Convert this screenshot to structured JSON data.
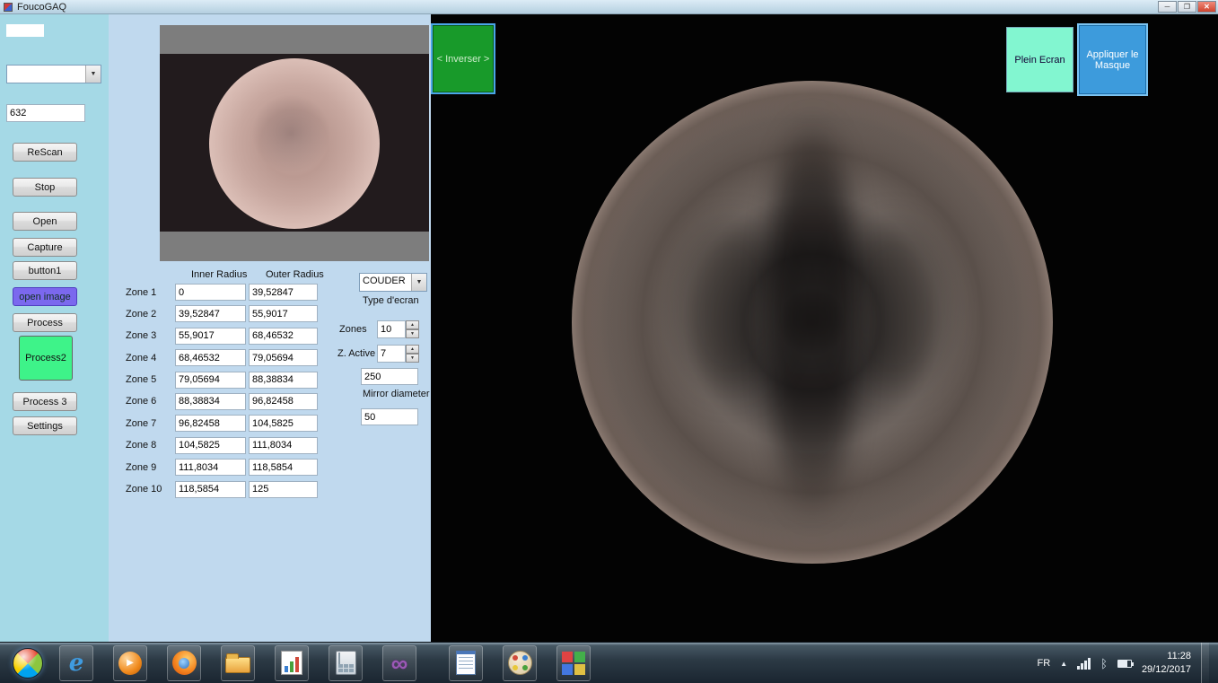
{
  "window": {
    "title": "FoucoGAQ"
  },
  "sidebar": {
    "combo_value": "",
    "wavelength": "632",
    "buttons": {
      "rescan": "ReScan",
      "stop": "Stop",
      "open": "Open",
      "capture": "Capture",
      "button1": "button1",
      "open_image": "open image",
      "process": "Process",
      "process2": "Process2",
      "process3": "Process 3",
      "settings": "Settings"
    }
  },
  "zones": {
    "inner_header": "Inner Radius",
    "outer_header": "Outer Radius",
    "rows": [
      {
        "label": "Zone 1",
        "inner": "0",
        "outer": "39,52847"
      },
      {
        "label": "Zone 2",
        "inner": "39,52847",
        "outer": "55,9017"
      },
      {
        "label": "Zone 3",
        "inner": "55,9017",
        "outer": "68,46532"
      },
      {
        "label": "Zone 4",
        "inner": "68,46532",
        "outer": "79,05694"
      },
      {
        "label": "Zone 5",
        "inner": "79,05694",
        "outer": "88,38834"
      },
      {
        "label": "Zone 6",
        "inner": "88,38834",
        "outer": "96,82458"
      },
      {
        "label": "Zone 7",
        "inner": "96,82458",
        "outer": "104,5825"
      },
      {
        "label": "Zone 8",
        "inner": "104,5825",
        "outer": "111,8034"
      },
      {
        "label": "Zone 9",
        "inner": "111,8034",
        "outer": "118,5854"
      },
      {
        "label": "Zone 10",
        "inner": "118,5854",
        "outer": "125"
      }
    ]
  },
  "controls": {
    "screen_type": "COUDER",
    "screen_type_label": "Type d'ecran",
    "zones_label": "Zones",
    "zones_count": "10",
    "active_label": "Z. Active",
    "active_count": "7",
    "radius_value": "250",
    "mirror_label": "Mirror diameter",
    "diameter_value": "50"
  },
  "viewer": {
    "inverser_label": "< Inverser >",
    "plein_ecran_label": "Plein Ecran",
    "appliquer_label": "Appliquer le Masque"
  },
  "taskbar": {
    "icons": [
      "start",
      "internet-explorer",
      "media-player",
      "firefox",
      "windows-explorer",
      "chart-app",
      "calculator",
      "visual-studio",
      "notepad",
      "paint",
      "color-squares"
    ],
    "tray": {
      "language": "FR",
      "time": "11:28",
      "date": "29/12/2017"
    }
  },
  "colors": {
    "sidebar_bg": "#a5d9e6",
    "midpanel_bg": "#c0d9ee",
    "open_image_bg": "#7b68ee",
    "process2_bg": "#3ef389",
    "inverser_bg": "#189a2a",
    "plein_ecran_bg": "#82f6d0",
    "appliquer_bg": "#3d9bdc"
  }
}
